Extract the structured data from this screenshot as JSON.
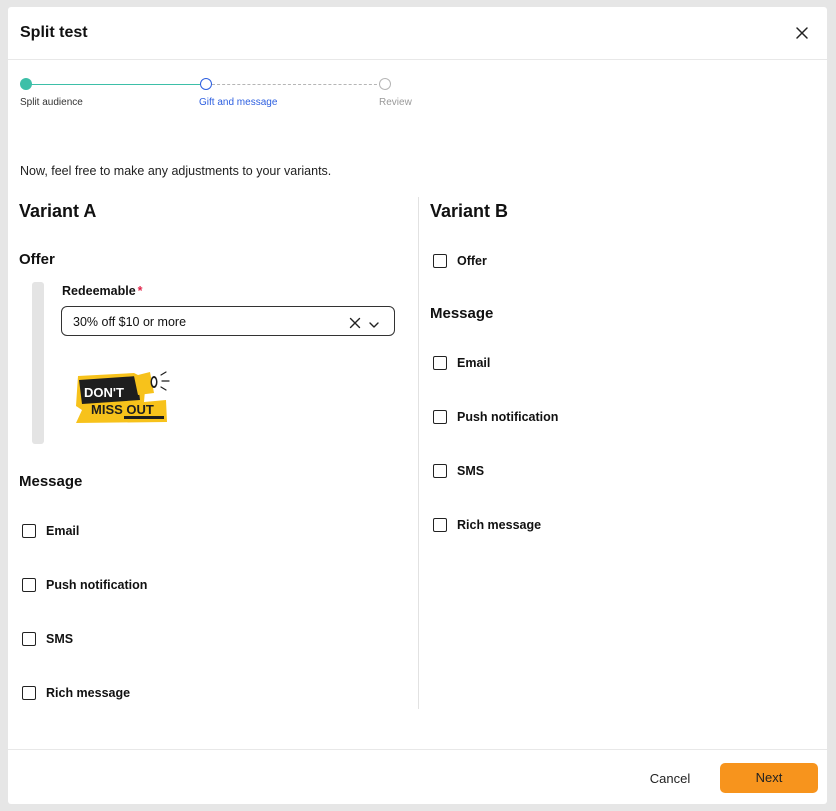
{
  "dialog": {
    "title": "Split test"
  },
  "stepper": {
    "steps": [
      {
        "label": "Split audience",
        "state": "completed"
      },
      {
        "label": "Gift and message",
        "state": "current"
      },
      {
        "label": "Review",
        "state": "upcoming"
      }
    ],
    "colors": {
      "completed": "#3dbfa8",
      "current": "#2d5fe0",
      "upcoming": "#b5b5b5"
    }
  },
  "intro_text": "Now, feel free to make any adjustments to your variants.",
  "variant_a": {
    "title": "Variant A",
    "offer": {
      "heading": "Offer",
      "field_label": "Redeemable",
      "required_mark": "*",
      "selected_value": "30% off  $10 or more",
      "badge": {
        "line1": "DON'T",
        "line2": "MISS OUT",
        "icon": "megaphone-icon"
      }
    },
    "message": {
      "heading": "Message",
      "options": [
        {
          "label": "Email",
          "checked": false
        },
        {
          "label": "Push notification",
          "checked": false
        },
        {
          "label": "SMS",
          "checked": false
        },
        {
          "label": "Rich message",
          "checked": false
        }
      ]
    }
  },
  "variant_b": {
    "title": "Variant B",
    "offer_option": {
      "label": "Offer",
      "checked": false
    },
    "message": {
      "heading": "Message",
      "options": [
        {
          "label": "Email",
          "checked": false
        },
        {
          "label": "Push notification",
          "checked": false
        },
        {
          "label": "SMS",
          "checked": false
        },
        {
          "label": "Rich message",
          "checked": false
        }
      ]
    }
  },
  "footer": {
    "cancel_label": "Cancel",
    "next_label": "Next",
    "accent_color": "#f7941d"
  }
}
